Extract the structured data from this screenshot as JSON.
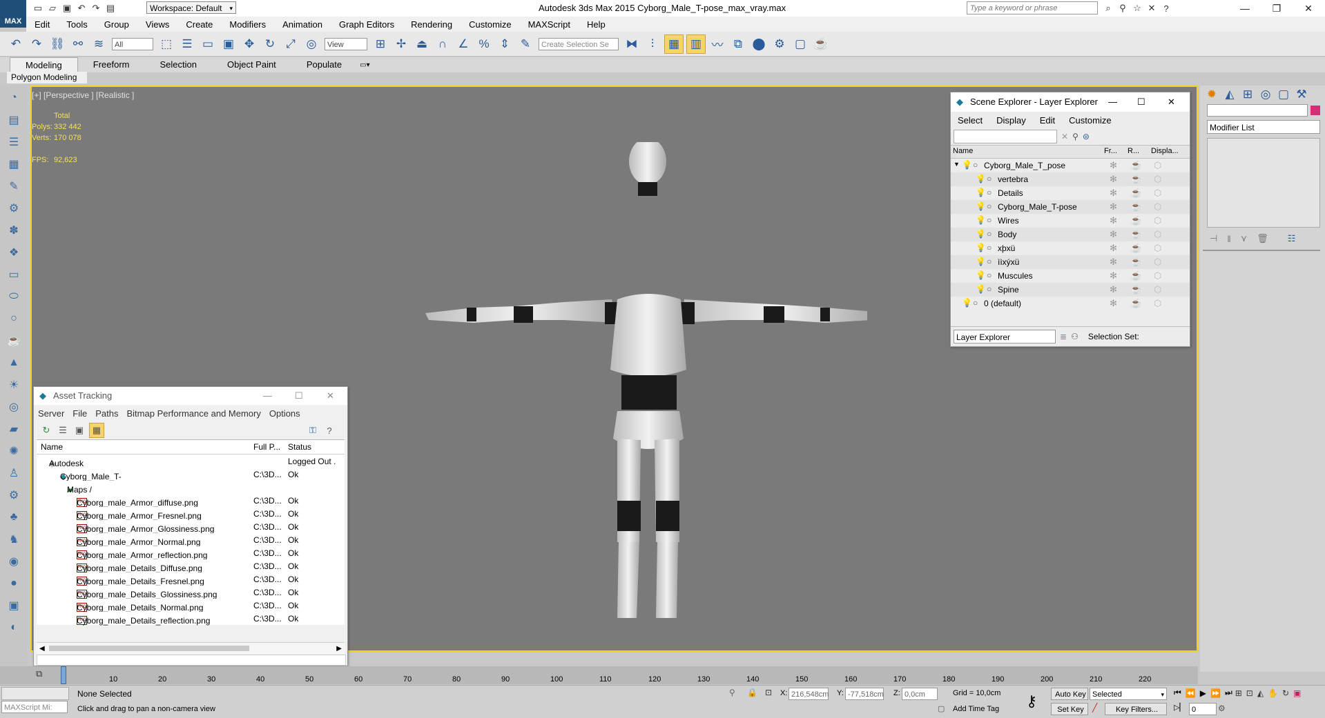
{
  "title_bar": {
    "workspace_label": "Workspace: Default",
    "app_title": "Autodesk 3ds Max  2015     Cyborg_Male_T-pose_max_vray.max",
    "search_placeholder": "Type a keyword or phrase",
    "logo_text": "MAX"
  },
  "menubar": {
    "items": [
      "Edit",
      "Tools",
      "Group",
      "Views",
      "Create",
      "Modifiers",
      "Animation",
      "Graph Editors",
      "Rendering",
      "Customize",
      "MAXScript",
      "Help"
    ]
  },
  "toolbar": {
    "filter_value": "All",
    "refcoord_value": "View",
    "selection_set_placeholder": "Create Selection Se"
  },
  "ribbon": {
    "tabs": [
      "Modeling",
      "Freeform",
      "Selection",
      "Object Paint",
      "Populate"
    ],
    "active_tab": "Modeling",
    "panel_label": "Polygon Modeling"
  },
  "viewport": {
    "label": "[+] [Perspective ] [Realistic ]",
    "stats": {
      "total_label": "Total",
      "polys_label": "Polys:",
      "polys_value": "332 442",
      "verts_label": "Verts:",
      "verts_value": "170 078",
      "fps_label": "FPS:",
      "fps_value": "92,623"
    }
  },
  "scene_explorer": {
    "title": "Scene Explorer - Layer Explorer",
    "menu": [
      "Select",
      "Display",
      "Edit",
      "Customize"
    ],
    "columns": [
      "Name",
      "Fr...",
      "R...",
      "Displa..."
    ],
    "rows": [
      {
        "name": "Cyborg_Male_T_pose",
        "indent": 0
      },
      {
        "name": "vertebra",
        "indent": 1
      },
      {
        "name": "Details",
        "indent": 1
      },
      {
        "name": "Cyborg_Male_T-pose",
        "indent": 1
      },
      {
        "name": "Wires",
        "indent": 1
      },
      {
        "name": "Body",
        "indent": 1
      },
      {
        "name": "xþxü",
        "indent": 1
      },
      {
        "name": "ììxýxü",
        "indent": 1
      },
      {
        "name": "Muscules",
        "indent": 1
      },
      {
        "name": "Spine",
        "indent": 1
      },
      {
        "name": "0 (default)",
        "indent": 0
      }
    ],
    "footer_dropdown": "Layer Explorer",
    "footer_label": "Selection Set:"
  },
  "modifier_panel": {
    "modifier_list_label": "Modifier List"
  },
  "asset_tracking": {
    "title": "Asset Tracking",
    "menu": [
      "Server",
      "File",
      "Paths",
      "Bitmap Performance and Memory",
      "Options"
    ],
    "columns": [
      "Name",
      "Full P...",
      "Status"
    ],
    "rows": [
      {
        "name": "Autodesk Vault",
        "path": "",
        "status": "Logged Out ."
      },
      {
        "name": "Cyborg_Male_T-pose_max_vray.max",
        "path": "C:\\3D...",
        "status": "Ok"
      },
      {
        "name": "Maps / Shaders",
        "path": "",
        "status": ""
      },
      {
        "name": "Cyborg_male_Armor_diffuse.png",
        "path": "C:\\3D...",
        "status": "Ok"
      },
      {
        "name": "Cyborg_male_Armor_Fresnel.png",
        "path": "C:\\3D...",
        "status": "Ok"
      },
      {
        "name": "Cyborg_male_Armor_Glossiness.png",
        "path": "C:\\3D...",
        "status": "Ok"
      },
      {
        "name": "Cyborg_male_Armor_Normal.png",
        "path": "C:\\3D...",
        "status": "Ok"
      },
      {
        "name": "Cyborg_male_Armor_reflection.png",
        "path": "C:\\3D...",
        "status": "Ok"
      },
      {
        "name": "Cyborg_male_Details_Diffuse.png",
        "path": "C:\\3D...",
        "status": "Ok"
      },
      {
        "name": "Cyborg_male_Details_Fresnel.png",
        "path": "C:\\3D...",
        "status": "Ok"
      },
      {
        "name": "Cyborg_male_Details_Glossiness.png",
        "path": "C:\\3D...",
        "status": "Ok"
      },
      {
        "name": "Cyborg_male_Details_Normal.png",
        "path": "C:\\3D...",
        "status": "Ok"
      },
      {
        "name": "Cyborg_male_Details_reflection.png",
        "path": "C:\\3D...",
        "status": "Ok"
      }
    ]
  },
  "timeline": {
    "ticks": [
      "10",
      "20",
      "30",
      "40",
      "50",
      "60",
      "70",
      "80",
      "90",
      "100",
      "110",
      "120",
      "130",
      "140",
      "150",
      "160",
      "170",
      "180",
      "190",
      "200",
      "210",
      "220"
    ]
  },
  "status_bar": {
    "maxscript_placeholder": "MAXScript Mi:",
    "selection_text": "None Selected",
    "prompt_text": "Click and drag to pan a non-camera view",
    "x_label": "X:",
    "x_value": "216,548cm",
    "y_label": "Y:",
    "y_value": "-77,518cm",
    "z_label": "Z:",
    "z_value": "0,0cm",
    "grid_text": "Grid = 10,0cm",
    "add_time_tag": "Add Time Tag",
    "auto_key": "Auto Key",
    "set_key": "Set Key",
    "selected_dropdown": "Selected",
    "key_filters": "Key Filters...",
    "frame_value": "0"
  },
  "colors": {
    "viewport_border": "#f3d21c",
    "viewport_bg": "#7a7a7a",
    "stats_text": "#f3e060"
  }
}
